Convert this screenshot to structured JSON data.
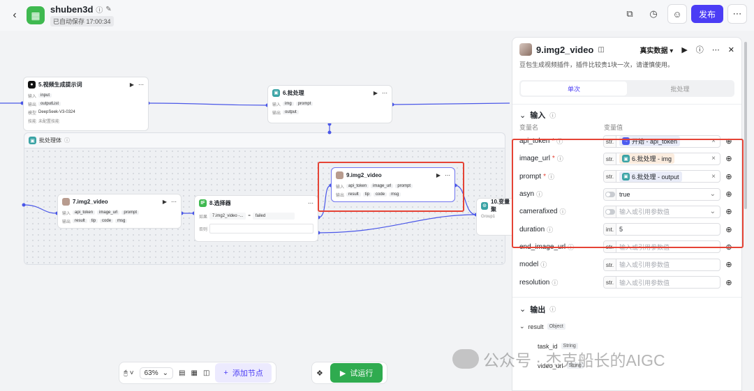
{
  "header": {
    "project_name": "shuben3d",
    "saved_text": "已自动保存 17:00:34",
    "publish_label": "发布"
  },
  "canvas": {
    "batch_container": {
      "title": "批处理体"
    },
    "nodes": {
      "prompt_gen": {
        "title": "5.视频生成提示词",
        "input_label": "输入",
        "input_chip": "input",
        "output_label": "输出",
        "output_chip": "outputList",
        "model_label": "模型",
        "model_value": "DeepSeek-V3-0324",
        "skill_label": "技能",
        "skill_value": "未配置技能"
      },
      "batch": {
        "title": "6.批处理",
        "input_label": "输入",
        "input_chips": [
          "img",
          "prompt"
        ],
        "output_label": "输出",
        "output_chip": "output"
      },
      "img2video_7": {
        "title": "7.img2_video",
        "input_label": "输入",
        "input_chips": [
          "api_token",
          "image_url",
          "prompt"
        ],
        "output_label": "输出",
        "output_chips": [
          "result",
          "tip",
          "code",
          "msg"
        ]
      },
      "selector": {
        "title": "8.选择器",
        "if_label": "如果",
        "if_var": "7.img2_video -...",
        "op": "=",
        "value": "failed",
        "else_label": "否则"
      },
      "img2video_9": {
        "title": "9.img2_video",
        "input_label": "输入",
        "input_chips": [
          "api_token",
          "image_url",
          "prompt"
        ],
        "output_label": "输出",
        "output_chips": [
          "result",
          "tip",
          "code",
          "msg"
        ]
      },
      "variable": {
        "title": "10.变量聚",
        "group_label": "Group1"
      }
    }
  },
  "toolbar": {
    "zoom": "63%",
    "add_node_label": "添加节点",
    "run_label": "试运行"
  },
  "panel": {
    "title": "9.img2_video",
    "mode_label": "真实数据",
    "description": "豆包生成视频插件，插件比较贵1块一次，请谨慎使用。",
    "tabs": [
      "单次",
      "批处理"
    ],
    "input_section": "输入",
    "col_name": "变量名",
    "col_value": "变量值",
    "params": [
      {
        "name": "api_token",
        "required": true,
        "type": "str.",
        "value": "开始 - api_token",
        "value_kind": "ref"
      },
      {
        "name": "image_url",
        "required": true,
        "type": "str.",
        "value": "6.批处理 - img",
        "value_kind": "ref-orange"
      },
      {
        "name": "prompt",
        "required": true,
        "type": "str.",
        "value": "6.批处理 - output",
        "value_kind": "ref"
      },
      {
        "name": "asyn",
        "required": false,
        "type": "toggle",
        "value": "true",
        "value_kind": "select"
      },
      {
        "name": "camerafixed",
        "required": false,
        "type": "toggle",
        "value": "输入或引用参数值",
        "value_kind": "placeholder-select"
      },
      {
        "name": "duration",
        "required": false,
        "type": "int.",
        "value": "5",
        "value_kind": "text"
      },
      {
        "name": "end_image_url",
        "required": false,
        "type": "str.",
        "value": "输入或引用参数值",
        "value_kind": "placeholder"
      },
      {
        "name": "model",
        "required": false,
        "type": "str.",
        "value": "输入或引用参数值",
        "value_kind": "placeholder"
      },
      {
        "name": "resolution",
        "required": false,
        "type": "str.",
        "value": "输入或引用参数值",
        "value_kind": "placeholder"
      }
    ],
    "output_section": "输出",
    "outputs": [
      {
        "name": "result",
        "type": "Object"
      },
      {
        "name": "task_id",
        "type": "String"
      },
      {
        "name": "video_url",
        "type": "String"
      }
    ]
  },
  "watermark": "公众号 · 杰克船长的AIGC"
}
